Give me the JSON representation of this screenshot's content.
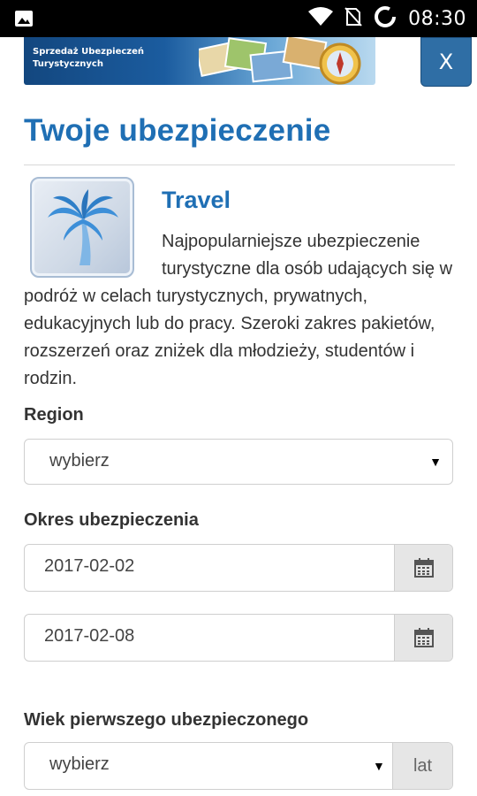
{
  "status_bar": {
    "time": "08:30",
    "icons": [
      "image-icon",
      "wifi-icon",
      "no-sim-icon",
      "sync-icon"
    ]
  },
  "banner": {
    "line1": "Sprzedaż Ubezpieczeń",
    "line2": "Turystycznych",
    "close_label": "X"
  },
  "page": {
    "title": "Twoje ubezpieczenie"
  },
  "product": {
    "name": "Travel",
    "icon": "palm-tree-icon",
    "description": "Najpopularniejsze ubezpieczenie turystyczne dla osób udających się w podróż w celach turystycznych, prywatnych, edukacyjnych lub do pracy. Szeroki zakres pakietów, rozszerzeń oraz zniżek dla młodzieży, studentów i rodzin."
  },
  "form": {
    "region": {
      "label": "Region",
      "value": "wybierz",
      "caret": "▼"
    },
    "period": {
      "label": "Okres ubezpieczenia",
      "start": "2017-02-02",
      "end": "2017-02-08"
    },
    "age": {
      "label": "Wiek pierwszego ubezpieczonego",
      "value": "wybierz",
      "caret": "▼",
      "unit": "lat"
    }
  },
  "colors": {
    "accent": "#1f6fb4",
    "status_bar": "#000000",
    "addon_bg": "#e6e6e6"
  }
}
